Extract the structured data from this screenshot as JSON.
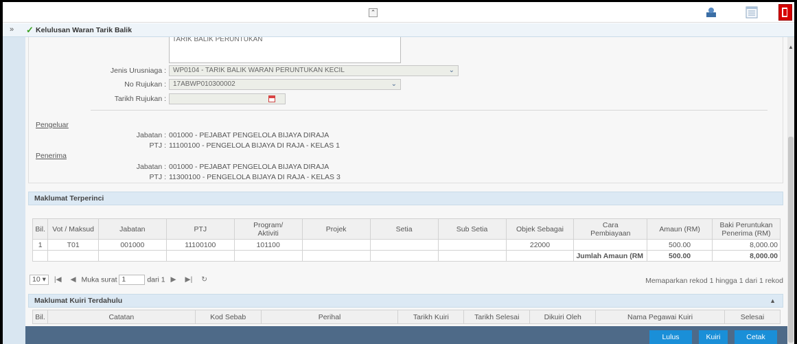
{
  "header": {
    "title": "Kelulusan Waran Tarik Balik"
  },
  "form": {
    "description_text": "TARIK BALIK PERUNTUKAN",
    "jenis_urusniaga_label": "Jenis Urusniaga :",
    "jenis_urusniaga_value": "WP0104 - TARIK BALIK WARAN PERUNTUKAN KECIL",
    "no_rujukan_label": "No Rujukan :",
    "no_rujukan_value": "17ABWP010300002",
    "tarikh_rujukan_label": "Tarikh Rujukan :",
    "tarikh_rujukan_value": ""
  },
  "pengeluar": {
    "title": "Pengeluar",
    "jabatan_label": "Jabatan :",
    "jabatan_value": "001000 - PEJABAT PENGELOLA BIJAYA DIRAJA",
    "ptj_label": "PTJ :",
    "ptj_value": "11100100 - PENGELOLA BIJAYA DI RAJA - KELAS 1"
  },
  "penerima": {
    "title": "Penerima",
    "jabatan_label": "Jabatan :",
    "jabatan_value": "001000 - PEJABAT PENGELOLA BIJAYA DIRAJA",
    "ptj_label": "PTJ :",
    "ptj_value": "11300100 - PENGELOLA BIJAYA DI RAJA - KELAS 3"
  },
  "detail": {
    "title": "Maklumat Terperinci",
    "columns": [
      "Bil.",
      "Vot / Maksud",
      "Jabatan",
      "PTJ",
      "Program/\nAktiviti",
      "Projek",
      "Setia",
      "Sub Setia",
      "Objek Sebagai",
      "Cara\nPembiayaan",
      "Amaun (RM)",
      "Baki Peruntukan\nPenerima (RM)"
    ],
    "row": {
      "bil": "1",
      "vot": "T01",
      "jabatan": "001000",
      "ptj": "11100100",
      "program": "101100",
      "projek": "",
      "setia": "",
      "sub_setia": "",
      "objek": "22000",
      "cara": "",
      "amaun": "500.00",
      "baki": "8,000.00"
    },
    "total_label": "Jumlah Amaun (RM",
    "total_amaun": "500.00",
    "total_baki": "8,000.00"
  },
  "pager": {
    "page_size": "10",
    "muka_surat_label": "Muka surat",
    "current_page": "1",
    "of_label": "dari 1",
    "summary": "Memaparkan rekod 1 hingga 1 dari 1 rekod"
  },
  "kuiri": {
    "title": "Maklumat Kuiri Terdahulu",
    "columns": [
      "Bil.",
      "Catatan",
      "Kod Sebab",
      "Perihal",
      "Tarikh Kuiri",
      "Tarikh Selesai",
      "Dikuiri Oleh",
      "Nama Pegawai Kuiri",
      "Selesai"
    ]
  },
  "actions": {
    "lulus": "Lulus",
    "kuiri": "Kuiri",
    "cetak": "Cetak"
  },
  "icons": {
    "collapse": "double-chevron-up-icon",
    "profile": "profile-icon",
    "list": "list-icon",
    "exit": "exit-door-icon",
    "expand": "double-chevron-right-icon",
    "check": "check-icon",
    "calendar": "calendar-icon"
  },
  "colors": {
    "accent": "#1a8fd8",
    "actionbar": "#4e6a88",
    "panel_header": "#dce9f4",
    "exit": "#d60000"
  }
}
